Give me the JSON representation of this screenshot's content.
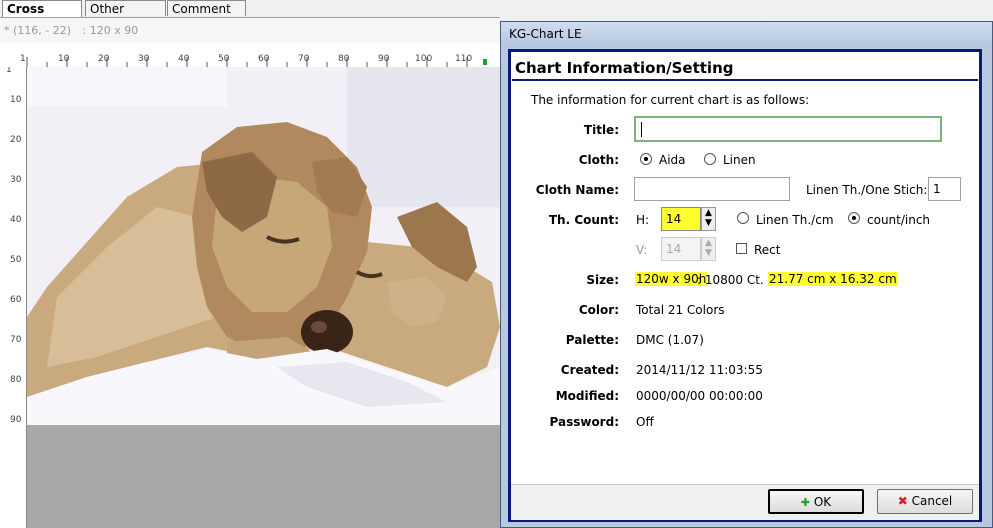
{
  "tabs": [
    {
      "label": "Cross Stitch",
      "active": true
    },
    {
      "label": "Other Stitch",
      "active": false
    },
    {
      "label": "Comment",
      "active": false
    }
  ],
  "status": {
    "coords": "* (116, - 22)",
    "size": ": 120 x 90"
  },
  "ruler": {
    "top_labels": [
      "1",
      "10",
      "20",
      "30",
      "40",
      "50",
      "60",
      "70",
      "80",
      "90",
      "100",
      "110"
    ],
    "left_labels": [
      "1",
      "10",
      "20",
      "30",
      "40",
      "50",
      "60",
      "70",
      "80",
      "90"
    ]
  },
  "dialog": {
    "window_title": "KG-Chart LE",
    "header": "Chart Information/Setting",
    "intro": "The information for current chart is as follows:",
    "title_label": "Title:",
    "title_value": "",
    "cloth_label": "Cloth:",
    "cloth_options": [
      "Aida",
      "Linen"
    ],
    "cloth_selected": "Aida",
    "cloth_name_label": "Cloth Name:",
    "cloth_name_value": "",
    "linen_label": "Linen Th./One Stich:",
    "linen_value": "1",
    "thcount_label": "Th. Count:",
    "h_label": "H:",
    "h_value": "14",
    "v_label": "V:",
    "v_value": "14",
    "unit_options": [
      "Linen Th./cm",
      "count/inch"
    ],
    "unit_selected": "count/inch",
    "rect_label": "Rect",
    "size_label": "Size:",
    "size_stitches": "120w x 90h",
    "size_count": ": 10800 Ct. :",
    "size_cm": "21.77 cm x 16.32 cm",
    "color_label": "Color:",
    "color_value": "Total 21 Colors",
    "palette_label": "Palette:",
    "palette_value": "DMC (1.07)",
    "created_label": "Created:",
    "created_value": "2014/11/12 11:03:55",
    "modified_label": "Modified:",
    "modified_value": "0000/00/00 00:00:00",
    "password_label": "Password:",
    "password_value": "Off",
    "ok_label": "OK",
    "cancel_label": "Cancel"
  }
}
